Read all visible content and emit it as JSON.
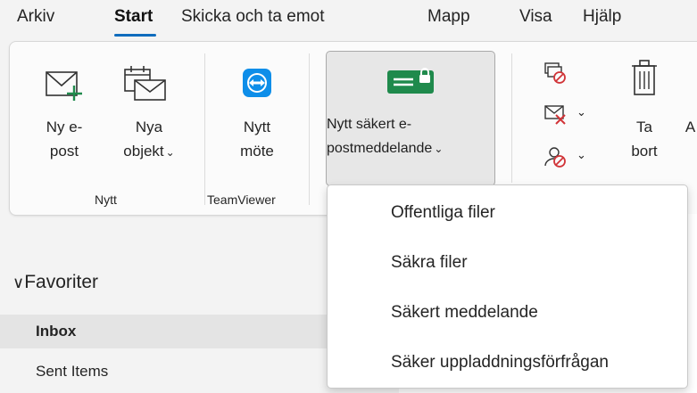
{
  "tabs": [
    {
      "label": "Arkiv"
    },
    {
      "label": "Start",
      "active": true
    },
    {
      "label": "Skicka och ta emot"
    },
    {
      "label": "Mapp"
    },
    {
      "label": "Visa"
    },
    {
      "label": "Hjälp"
    }
  ],
  "ribbon": {
    "new_email": {
      "line1": "Ny e-",
      "line2": "post",
      "icon": "new-mail-icon"
    },
    "new_items": {
      "line1": "Nya",
      "line2": "objekt",
      "icon": "new-items-icon"
    },
    "new_meeting": {
      "line1": "Nytt",
      "line2": "möte",
      "icon": "teamviewer-icon"
    },
    "secure_message": {
      "line1": "Nytt säkert e-",
      "line2": "postmeddelande",
      "icon": "secure-mail-icon"
    },
    "delete": {
      "line1": "Ta",
      "line2": "bort",
      "icon": "trash-icon"
    },
    "cut_off_letter": "A",
    "groups": {
      "new": "Nytt",
      "teamviewer": "TeamViewer"
    },
    "accent_green": "#1f8a4c"
  },
  "dropdown": {
    "items": [
      {
        "label": "Offentliga filer"
      },
      {
        "label": "Säkra filer"
      },
      {
        "label": "Säkert meddelande"
      },
      {
        "label": "Säker uppladdningsförfrågan"
      }
    ]
  },
  "sidebar": {
    "favorites_label": "Favoriter",
    "items": [
      {
        "label": "Inbox",
        "selected": true
      },
      {
        "label": "Sent Items"
      }
    ]
  }
}
